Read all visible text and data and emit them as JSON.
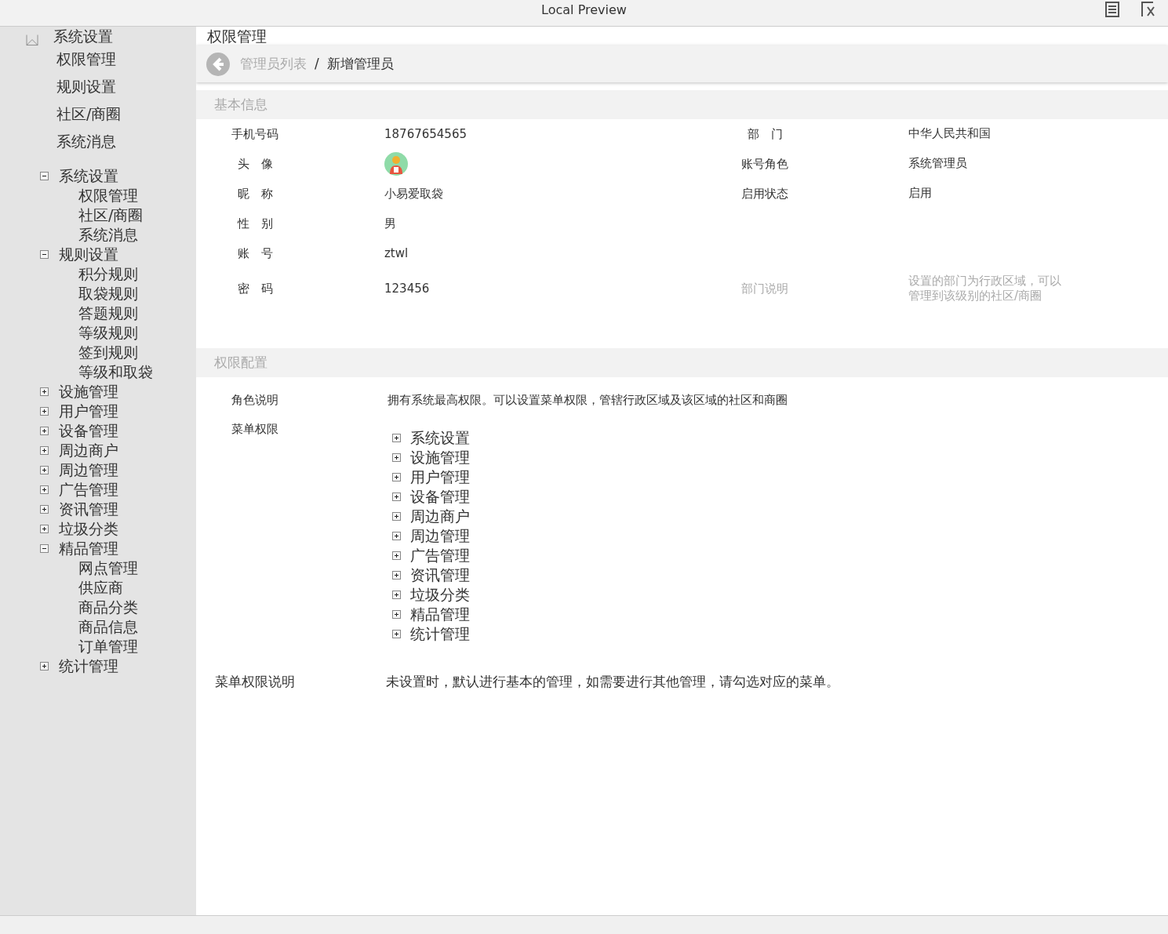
{
  "title_bar": {
    "title": "Local Preview"
  },
  "sidebar": {
    "top_items": [
      {
        "label": "系统设置",
        "kind": "image"
      },
      {
        "label": "权限管理",
        "kind": "plain"
      },
      {
        "label": "规则设置",
        "kind": "plain"
      },
      {
        "label": "社区/商圈",
        "kind": "plain"
      },
      {
        "label": "系统消息",
        "kind": "plain"
      }
    ],
    "tree": [
      {
        "label": "系统设置",
        "expanded": true,
        "children": [
          {
            "label": "权限管理"
          },
          {
            "label": "社区/商圈"
          },
          {
            "label": "系统消息"
          }
        ]
      },
      {
        "label": "规则设置",
        "expanded": true,
        "children": [
          {
            "label": "积分规则"
          },
          {
            "label": "取袋规则"
          },
          {
            "label": "答题规则"
          },
          {
            "label": "等级规则"
          },
          {
            "label": "签到规则"
          },
          {
            "label": "等级和取袋"
          }
        ]
      },
      {
        "label": "设施管理",
        "expanded": false
      },
      {
        "label": "用户管理",
        "expanded": false
      },
      {
        "label": "设备管理",
        "expanded": false
      },
      {
        "label": "周边商户",
        "expanded": false
      },
      {
        "label": "周边管理",
        "expanded": false
      },
      {
        "label": "广告管理",
        "expanded": false
      },
      {
        "label": "资讯管理",
        "expanded": false
      },
      {
        "label": "垃圾分类",
        "expanded": false
      },
      {
        "label": "精品管理",
        "expanded": true,
        "children": [
          {
            "label": "网点管理"
          },
          {
            "label": "供应商"
          },
          {
            "label": "商品分类"
          },
          {
            "label": "商品信息"
          },
          {
            "label": "订单管理"
          }
        ]
      },
      {
        "label": "统计管理",
        "expanded": false
      }
    ]
  },
  "main": {
    "heading": "权限管理",
    "breadcrumb_separator": "/",
    "breadcrumb": [
      {
        "label": "管理员列表",
        "selected": false
      },
      {
        "label": "新增管理员",
        "selected": true
      }
    ],
    "basic_info": {
      "title": "基本信息",
      "rows": [
        {
          "left": {
            "label": "手机号码",
            "value": "18767654565",
            "kind": "text"
          },
          "right": {
            "label": "部　门",
            "value": "中华人民共和国",
            "muted": false
          }
        },
        {
          "left": {
            "label": "头　像",
            "kind": "avatar"
          },
          "right": {
            "label": "账号角色",
            "value": "系统管理员",
            "muted": false
          }
        },
        {
          "left": {
            "label": "昵　称",
            "value": "小易爱取袋",
            "kind": "text"
          },
          "right": {
            "label": "启用状态",
            "value": "启用",
            "muted": false
          }
        },
        {
          "left": {
            "label": "性　别",
            "value": "男",
            "kind": "text"
          }
        },
        {
          "left": {
            "label": "账　号",
            "value": "ztwl",
            "kind": "text"
          }
        },
        {
          "left": {
            "label": "密　码",
            "value": "123456",
            "kind": "text"
          },
          "right": {
            "label": "部门说明",
            "value": "设置的部门为行政区域，可以管理到该级别的社区/商圈",
            "muted": true
          }
        }
      ]
    },
    "permissions": {
      "title": "权限配置",
      "role_label": "角色说明",
      "role_text": "拥有系统最高权限。可以设置菜单权限，管辖行政区域及该区域的社区和商圈",
      "menu_label": "菜单权限",
      "menu_tree": [
        {
          "label": "系统设置",
          "expanded": false
        },
        {
          "label": "设施管理",
          "expanded": false
        },
        {
          "label": "用户管理",
          "expanded": false
        },
        {
          "label": "设备管理",
          "expanded": false
        },
        {
          "label": "周边商户",
          "expanded": false
        },
        {
          "label": "周边管理",
          "expanded": false
        },
        {
          "label": "广告管理",
          "expanded": false
        },
        {
          "label": "资讯管理",
          "expanded": false
        },
        {
          "label": "垃圾分类",
          "expanded": false
        },
        {
          "label": "精品管理",
          "expanded": false
        },
        {
          "label": "统计管理",
          "expanded": false
        }
      ],
      "note_label": "菜单权限说明",
      "note_text": "未设置时，默认进行基本的管理，如需要进行其他管理，请勾选对应的菜单。"
    }
  }
}
